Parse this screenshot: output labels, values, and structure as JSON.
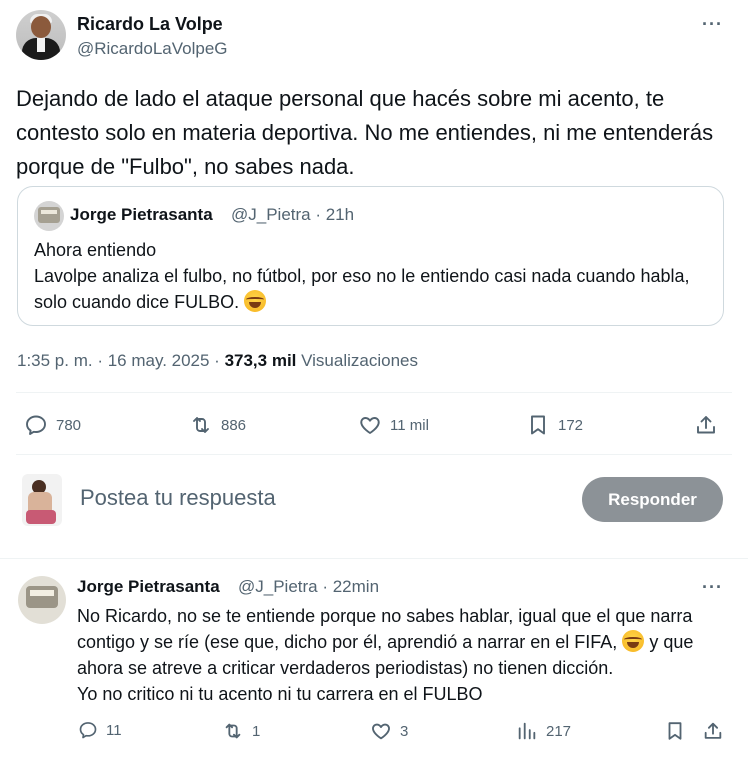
{
  "main_tweet": {
    "author_name": "Ricardo La Volpe",
    "author_handle": "@RicardoLaVolpeG",
    "more": "···",
    "text": "Dejando de lado el ataque personal que hacés sobre mi acento, te contesto solo en materia deportiva. No me entiendes, ni me entenderás porque de \"Fulbo\", no sabes nada.",
    "quote": {
      "author_name": "Jorge Pietrasanta",
      "meta": "@J_Pietra · 21h",
      "line1": "Ahora entiendo",
      "line2": "Lavolpe analiza el fulbo, no fútbol, por eso no le entiendo casi nada cuando habla, solo cuando dice FULBO."
    },
    "timestamp": "1:35 p. m. · 16 may. 2025 · ",
    "views_count": "373,3 mil",
    "views_label": " Visualizaciones",
    "actions": {
      "replies": "780",
      "reposts": "886",
      "likes": "11 mil",
      "bookmarks": "172"
    }
  },
  "composer": {
    "placeholder": "Postea tu respuesta",
    "button": "Responder"
  },
  "reply": {
    "author_name": "Jorge Pietrasanta",
    "meta": "@J_Pietra · 22min",
    "more": "···",
    "line1": "No Ricardo, no se te entiende porque no sabes hablar, igual que el que narra contigo y se ríe (ese que, dicho por él, aprendió a narrar en el FIFA,",
    "line2": " y que ahora se atreve a criticar verdaderos periodistas)  no tienen dicción.",
    "line3": "Yo no critico ni tu acento ni tu carrera en el FULBO",
    "actions": {
      "replies": "11",
      "reposts": "1",
      "likes": "3",
      "views": "217"
    }
  },
  "colors": {
    "text": "#0f1419",
    "secondary": "#536471",
    "border": "#cfd9de",
    "button_disabled": "#8c9297"
  }
}
